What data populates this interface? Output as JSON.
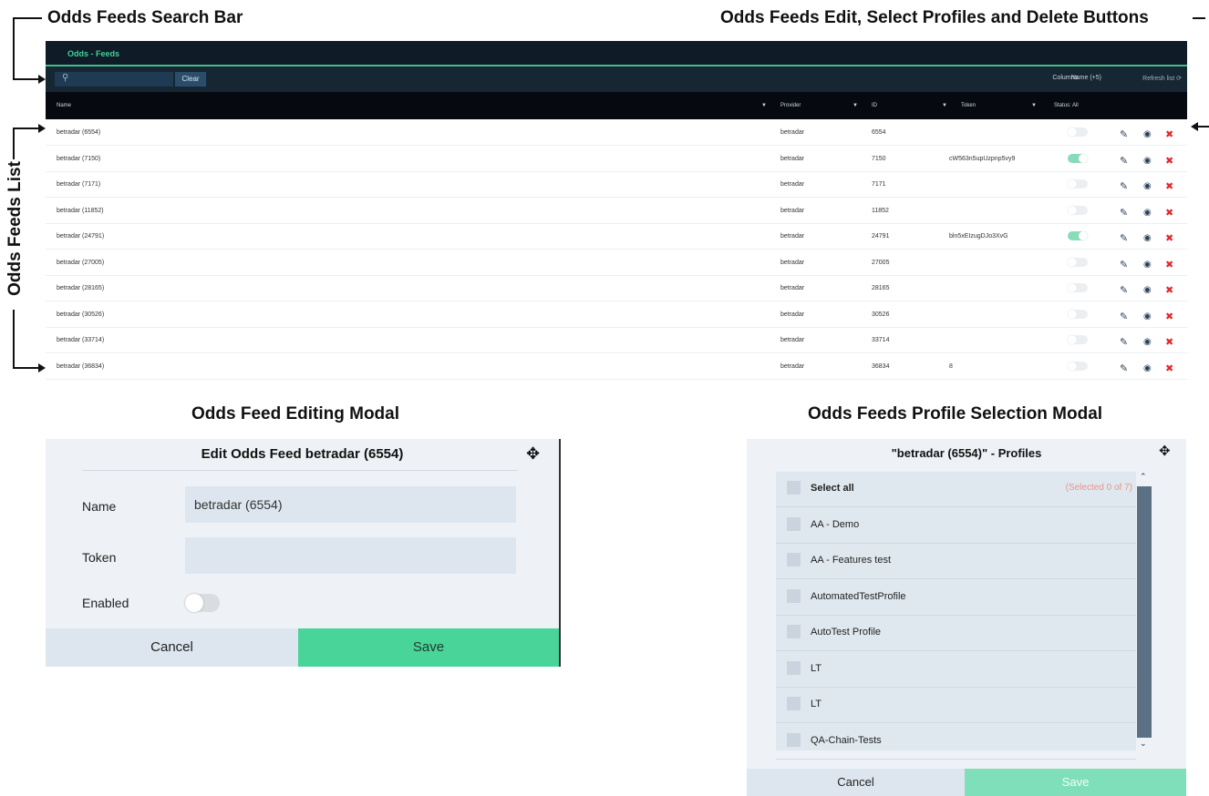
{
  "annotations": {
    "search_bar": "Odds Feeds Search  Bar",
    "buttons": "Odds Feeds  Edit, Select Profiles and Delete Buttons",
    "list": "Odds Feeds List",
    "edit_modal": "Odds Feed Editing Modal",
    "profile_modal": "Odds Feeds Profile Selection Modal"
  },
  "app": {
    "title": "Odds - Feeds",
    "search": {
      "placeholder": "",
      "clear_label": "Clear"
    },
    "columns_label": "Columns",
    "columns_value": "Name (+5)",
    "refresh_label": "Refresh list",
    "headers": {
      "name": "Name",
      "provider": "Provider",
      "id": "ID",
      "token": "Token",
      "status": "Status: All"
    },
    "rows": [
      {
        "name": "betradar (6554)",
        "provider": "betradar",
        "id": "6554",
        "token": "",
        "enabled": false
      },
      {
        "name": "betradar (7150)",
        "provider": "betradar",
        "id": "7150",
        "token": "cW563n5upUzpnp5vy9",
        "enabled": true
      },
      {
        "name": "betradar (7171)",
        "provider": "betradar",
        "id": "7171",
        "token": "",
        "enabled": false
      },
      {
        "name": "betradar (11852)",
        "provider": "betradar",
        "id": "11852",
        "token": "",
        "enabled": false
      },
      {
        "name": "betradar (24791)",
        "provider": "betradar",
        "id": "24791",
        "token": "bln5xEIzugDJo3XvG",
        "enabled": true
      },
      {
        "name": "betradar (27005)",
        "provider": "betradar",
        "id": "27005",
        "token": "",
        "enabled": false
      },
      {
        "name": "betradar (28165)",
        "provider": "betradar",
        "id": "28165",
        "token": "",
        "enabled": false
      },
      {
        "name": "betradar (30526)",
        "provider": "betradar",
        "id": "30526",
        "token": "",
        "enabled": false
      },
      {
        "name": "betradar (33714)",
        "provider": "betradar",
        "id": "33714",
        "token": "",
        "enabled": false
      },
      {
        "name": "betradar (36834)",
        "provider": "betradar",
        "id": "36834",
        "token": "8",
        "enabled": false
      }
    ]
  },
  "edit_modal": {
    "title": "Edit Odds Feed betradar (6554)",
    "name_label": "Name",
    "name_value": "betradar (6554)",
    "token_label": "Token",
    "token_value": "",
    "enabled_label": "Enabled",
    "enabled": false,
    "cancel_label": "Cancel",
    "save_label": "Save"
  },
  "profile_modal": {
    "title": "\"betradar (6554)\" - Profiles",
    "select_all_label": "Select all",
    "selected_count": "(Selected 0 of 7)",
    "profiles": [
      "AA - Demo",
      "AA - Features test",
      "AutomatedTestProfile",
      "AutoTest Profile",
      "LT",
      "LT",
      "QA-Chain-Tests"
    ],
    "cancel_label": "Cancel",
    "save_label": "Save"
  },
  "colors": {
    "accent": "#49d49a",
    "header": "#0f1b26",
    "delete": "#e02a2a"
  }
}
